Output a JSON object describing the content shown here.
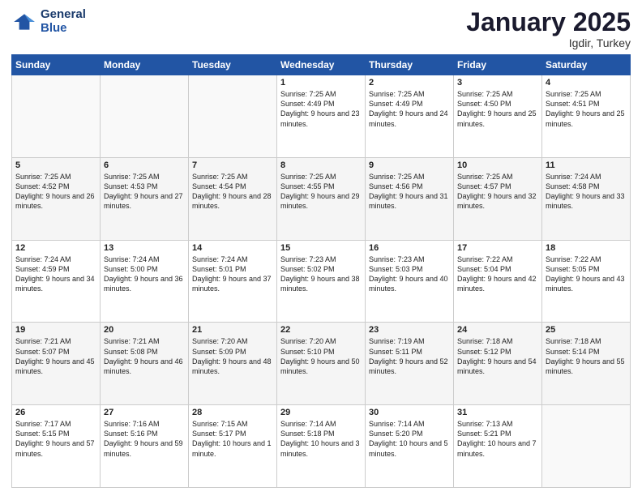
{
  "logo": {
    "line1": "General",
    "line2": "Blue"
  },
  "title": "January 2025",
  "subtitle": "Igdir, Turkey",
  "days_of_week": [
    "Sunday",
    "Monday",
    "Tuesday",
    "Wednesday",
    "Thursday",
    "Friday",
    "Saturday"
  ],
  "weeks": [
    [
      {
        "day": "",
        "empty": true
      },
      {
        "day": "",
        "empty": true
      },
      {
        "day": "",
        "empty": true
      },
      {
        "day": "1",
        "sunrise": "7:25 AM",
        "sunset": "4:49 PM",
        "daylight": "9 hours and 23 minutes."
      },
      {
        "day": "2",
        "sunrise": "7:25 AM",
        "sunset": "4:49 PM",
        "daylight": "9 hours and 24 minutes."
      },
      {
        "day": "3",
        "sunrise": "7:25 AM",
        "sunset": "4:50 PM",
        "daylight": "9 hours and 25 minutes."
      },
      {
        "day": "4",
        "sunrise": "7:25 AM",
        "sunset": "4:51 PM",
        "daylight": "9 hours and 25 minutes."
      }
    ],
    [
      {
        "day": "5",
        "sunrise": "7:25 AM",
        "sunset": "4:52 PM",
        "daylight": "9 hours and 26 minutes."
      },
      {
        "day": "6",
        "sunrise": "7:25 AM",
        "sunset": "4:53 PM",
        "daylight": "9 hours and 27 minutes."
      },
      {
        "day": "7",
        "sunrise": "7:25 AM",
        "sunset": "4:54 PM",
        "daylight": "9 hours and 28 minutes."
      },
      {
        "day": "8",
        "sunrise": "7:25 AM",
        "sunset": "4:55 PM",
        "daylight": "9 hours and 29 minutes."
      },
      {
        "day": "9",
        "sunrise": "7:25 AM",
        "sunset": "4:56 PM",
        "daylight": "9 hours and 31 minutes."
      },
      {
        "day": "10",
        "sunrise": "7:25 AM",
        "sunset": "4:57 PM",
        "daylight": "9 hours and 32 minutes."
      },
      {
        "day": "11",
        "sunrise": "7:24 AM",
        "sunset": "4:58 PM",
        "daylight": "9 hours and 33 minutes."
      }
    ],
    [
      {
        "day": "12",
        "sunrise": "7:24 AM",
        "sunset": "4:59 PM",
        "daylight": "9 hours and 34 minutes."
      },
      {
        "day": "13",
        "sunrise": "7:24 AM",
        "sunset": "5:00 PM",
        "daylight": "9 hours and 36 minutes."
      },
      {
        "day": "14",
        "sunrise": "7:24 AM",
        "sunset": "5:01 PM",
        "daylight": "9 hours and 37 minutes."
      },
      {
        "day": "15",
        "sunrise": "7:23 AM",
        "sunset": "5:02 PM",
        "daylight": "9 hours and 38 minutes."
      },
      {
        "day": "16",
        "sunrise": "7:23 AM",
        "sunset": "5:03 PM",
        "daylight": "9 hours and 40 minutes."
      },
      {
        "day": "17",
        "sunrise": "7:22 AM",
        "sunset": "5:04 PM",
        "daylight": "9 hours and 42 minutes."
      },
      {
        "day": "18",
        "sunrise": "7:22 AM",
        "sunset": "5:05 PM",
        "daylight": "9 hours and 43 minutes."
      }
    ],
    [
      {
        "day": "19",
        "sunrise": "7:21 AM",
        "sunset": "5:07 PM",
        "daylight": "9 hours and 45 minutes."
      },
      {
        "day": "20",
        "sunrise": "7:21 AM",
        "sunset": "5:08 PM",
        "daylight": "9 hours and 46 minutes."
      },
      {
        "day": "21",
        "sunrise": "7:20 AM",
        "sunset": "5:09 PM",
        "daylight": "9 hours and 48 minutes."
      },
      {
        "day": "22",
        "sunrise": "7:20 AM",
        "sunset": "5:10 PM",
        "daylight": "9 hours and 50 minutes."
      },
      {
        "day": "23",
        "sunrise": "7:19 AM",
        "sunset": "5:11 PM",
        "daylight": "9 hours and 52 minutes."
      },
      {
        "day": "24",
        "sunrise": "7:18 AM",
        "sunset": "5:12 PM",
        "daylight": "9 hours and 54 minutes."
      },
      {
        "day": "25",
        "sunrise": "7:18 AM",
        "sunset": "5:14 PM",
        "daylight": "9 hours and 55 minutes."
      }
    ],
    [
      {
        "day": "26",
        "sunrise": "7:17 AM",
        "sunset": "5:15 PM",
        "daylight": "9 hours and 57 minutes."
      },
      {
        "day": "27",
        "sunrise": "7:16 AM",
        "sunset": "5:16 PM",
        "daylight": "9 hours and 59 minutes."
      },
      {
        "day": "28",
        "sunrise": "7:15 AM",
        "sunset": "5:17 PM",
        "daylight": "10 hours and 1 minute."
      },
      {
        "day": "29",
        "sunrise": "7:14 AM",
        "sunset": "5:18 PM",
        "daylight": "10 hours and 3 minutes."
      },
      {
        "day": "30",
        "sunrise": "7:14 AM",
        "sunset": "5:20 PM",
        "daylight": "10 hours and 5 minutes."
      },
      {
        "day": "31",
        "sunrise": "7:13 AM",
        "sunset": "5:21 PM",
        "daylight": "10 hours and 7 minutes."
      },
      {
        "day": "",
        "empty": true
      }
    ]
  ]
}
